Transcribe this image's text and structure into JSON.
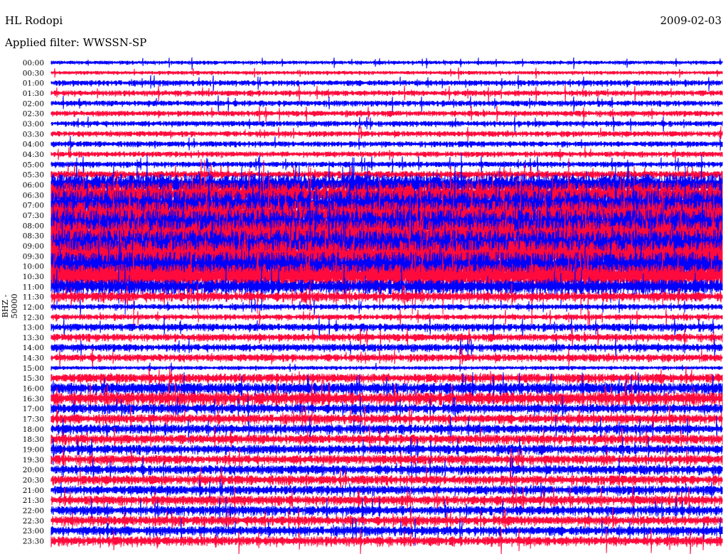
{
  "header": {
    "station": "HL Rodopi",
    "filter": "Applied filter: WWSSN-SP",
    "date": "2009-02-03"
  },
  "chart_data": {
    "type": "line",
    "title": "HL Rodopi",
    "subtitle": "Applied filter: WWSSN-SP",
    "date": "2009-02-03",
    "ylabel": "BHZ - 50000",
    "xlabel": "",
    "colors": [
      "#0000ff",
      "#ff0a3c"
    ],
    "rows": [
      "00:00",
      "00:30",
      "01:00",
      "01:30",
      "02:00",
      "02:30",
      "03:00",
      "03:30",
      "04:00",
      "04:30",
      "05:00",
      "05:30",
      "06:00",
      "06:30",
      "07:00",
      "07:30",
      "08:00",
      "08:30",
      "09:00",
      "09:30",
      "10:00",
      "10:30",
      "11:00",
      "11:30",
      "12:00",
      "12:30",
      "13:00",
      "13:30",
      "14:00",
      "14:30",
      "15:00",
      "15:30",
      "16:00",
      "16:30",
      "17:00",
      "17:30",
      "18:00",
      "18:30",
      "19:00",
      "19:30",
      "20:00",
      "20:30",
      "21:00",
      "21:30",
      "22:00",
      "22:30",
      "23:00",
      "23:30"
    ],
    "relative_amplitude": [
      2,
      2,
      3,
      3,
      3,
      3,
      3,
      3,
      3,
      3,
      3,
      4,
      12,
      14,
      16,
      16,
      18,
      18,
      18,
      18,
      16,
      14,
      8,
      5,
      3,
      3,
      4,
      4,
      4,
      4,
      2,
      5,
      6,
      7,
      5,
      5,
      5,
      5,
      5,
      5,
      5,
      5,
      5,
      5,
      5,
      5,
      5,
      5
    ]
  }
}
